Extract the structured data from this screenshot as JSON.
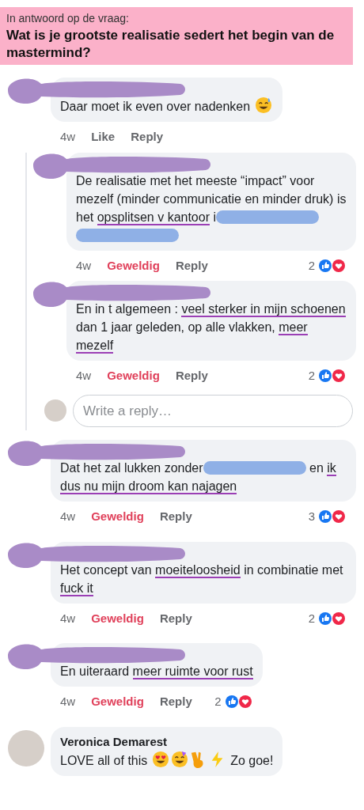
{
  "question": {
    "intro": "In antwoord op de vraag:",
    "title": "Wat is je grootste realisatie sedert het begin van de mastermind?"
  },
  "comments": [
    {
      "body": [
        {
          "kind": "plain",
          "text": "Daar moet ik even over nadenken "
        },
        {
          "kind": "sweat-smile"
        }
      ],
      "time": "4w",
      "reaction": {
        "label": "Like",
        "reacted": false
      },
      "reply": "Reply",
      "children": [
        {
          "body": [
            {
              "kind": "plain",
              "text": "De realisatie met het meeste “impact” voor mezelf (minder communicatie en minder druk) is het "
            },
            {
              "kind": "underline",
              "text": "opsplitsen v kantoor"
            },
            {
              "kind": "plain",
              "text": " i"
            },
            {
              "kind": "redacted"
            },
            {
              "kind": "redacted"
            }
          ],
          "time": "4w",
          "reaction": {
            "label": "Geweldig",
            "reacted": true
          },
          "reply": "Reply",
          "count": "2"
        },
        {
          "body": [
            {
              "kind": "plain",
              "text": "En in t algemeen : "
            },
            {
              "kind": "underline",
              "text": "veel sterker in mijn schoenen"
            },
            {
              "kind": "plain",
              "text": " dan 1 jaar geleden, op alle vlakken, "
            },
            {
              "kind": "underline",
              "text": "meer mezelf"
            }
          ],
          "time": "4w",
          "reaction": {
            "label": "Geweldig",
            "reacted": true
          },
          "reply": "Reply",
          "count": "2"
        }
      ],
      "reply_box": {
        "placeholder": "Write a reply…"
      }
    },
    {
      "body": [
        {
          "kind": "plain",
          "text": "Dat het zal lukken zonder"
        },
        {
          "kind": "redacted"
        },
        {
          "kind": "plain",
          "text": " en "
        },
        {
          "kind": "underline",
          "text": "ik dus nu mijn droom kan najagen"
        }
      ],
      "time": "4w",
      "reaction": {
        "label": "Geweldig",
        "reacted": true
      },
      "reply": "Reply",
      "count": "3"
    },
    {
      "body": [
        {
          "kind": "plain",
          "text": "Het concept van "
        },
        {
          "kind": "underline",
          "text": "moeiteloosheid"
        },
        {
          "kind": "plain",
          "text": " in combinatie met "
        },
        {
          "kind": "underline",
          "text": "fuck it"
        }
      ],
      "time": "4w",
      "reaction": {
        "label": "Geweldig",
        "reacted": true
      },
      "reply": "Reply",
      "count": "2"
    },
    {
      "body": [
        {
          "kind": "plain",
          "text": "En uiteraard "
        },
        {
          "kind": "underline",
          "text": "meer ruimte voor rust"
        }
      ],
      "time": "4w",
      "reaction": {
        "label": "Geweldig",
        "reacted": true
      },
      "reply": "Reply",
      "count": "2"
    },
    {
      "author": "Veronica Demarest",
      "body": [
        {
          "kind": "plain",
          "text": "LOVE all of this "
        },
        {
          "kind": "heart-eyes"
        },
        {
          "kind": "party-face"
        },
        {
          "kind": "victory-hand"
        },
        {
          "kind": "lightning"
        },
        {
          "kind": "plain",
          "text": " Zo goe!"
        }
      ]
    }
  ]
}
